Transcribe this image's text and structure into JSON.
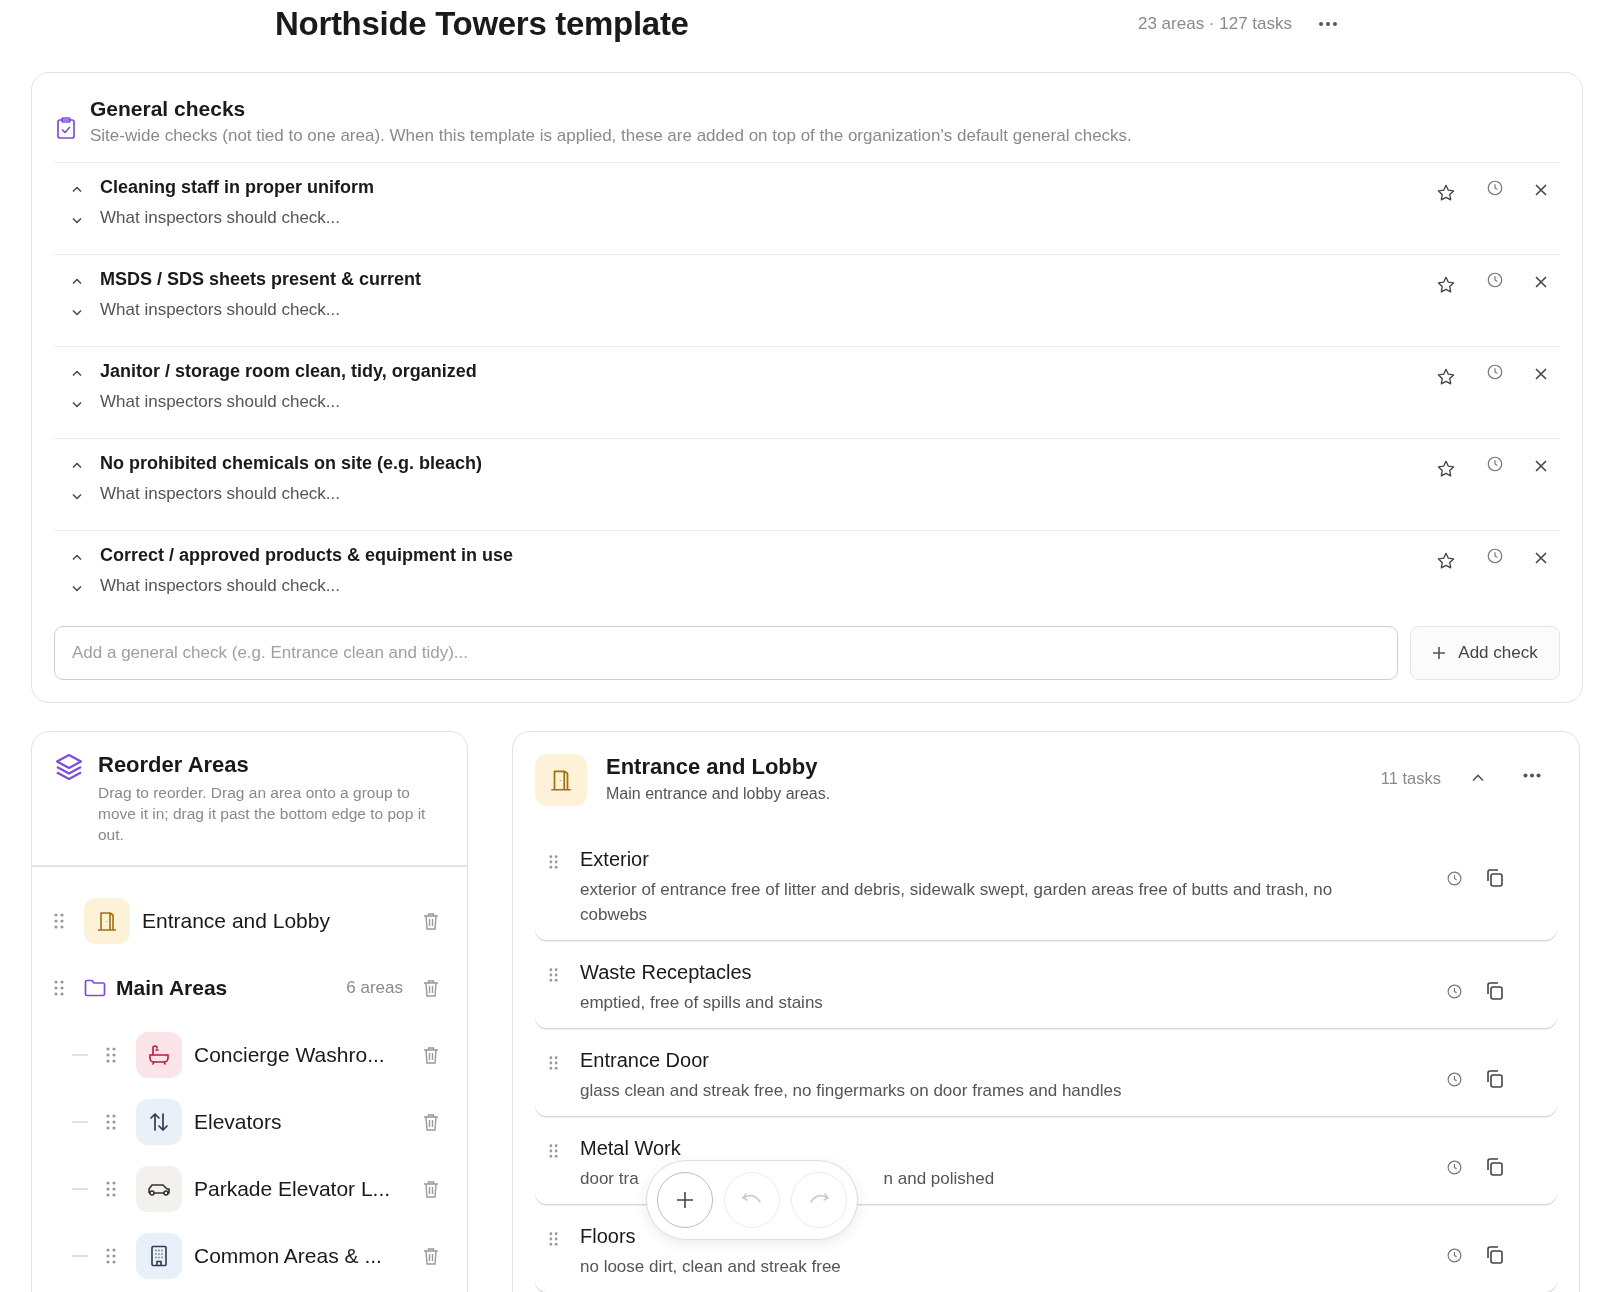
{
  "header": {
    "title": "Northside Towers template",
    "summary": "23 areas · 127 tasks"
  },
  "general_checks": {
    "title": "General checks",
    "description": "Site-wide checks (not tied to one area). When this template is applied, these are added on top of the organization's default general checks.",
    "checks": [
      {
        "title": "Cleaning staff in proper uniform",
        "placeholder": "What inspectors should check..."
      },
      {
        "title": "MSDS / SDS sheets present & current",
        "placeholder": "What inspectors should check..."
      },
      {
        "title": "Janitor / storage room clean, tidy, organized",
        "placeholder": "What inspectors should check..."
      },
      {
        "title": "No prohibited chemicals on site (e.g. bleach)",
        "placeholder": "What inspectors should check..."
      },
      {
        "title": "Correct / approved products & equipment in use",
        "placeholder": "What inspectors should check..."
      }
    ],
    "add_field": {
      "placeholder": "Add a general check (e.g. Entrance clean and tidy)..."
    },
    "add_button": "Add check"
  },
  "reorder_panel": {
    "title": "Reorder Areas",
    "description": "Drag to reorder. Drag an area onto a group to move it in; drag it past the bottom edge to pop it out.",
    "items": [
      {
        "kind": "area",
        "name": "Entrance and Lobby",
        "color": "#fdf2d8"
      },
      {
        "kind": "group",
        "name": "Main Areas",
        "count": "6 areas",
        "children": [
          {
            "kind": "area",
            "name": "Concierge Washro...",
            "color": "#fbe4e8"
          },
          {
            "kind": "area",
            "name": "Elevators",
            "color": "#eaf0f8"
          },
          {
            "kind": "area",
            "name": "Parkade Elevator L...",
            "color": "#f3f1ee"
          },
          {
            "kind": "area",
            "name": "Common Areas & ...",
            "color": "#eaf0f8"
          }
        ]
      }
    ]
  },
  "area_detail": {
    "title": "Entrance and Lobby",
    "subtitle": "Main entrance and lobby areas.",
    "task_count": "11 tasks",
    "expanded": true,
    "tasks": [
      {
        "title": "Exterior",
        "description": "exterior of entrance free of litter and debris, sidewalk swept, garden areas free of butts and trash, no cobwebs"
      },
      {
        "title": "Waste Receptacles",
        "description": "emptied, free of spills and stains"
      },
      {
        "title": "Entrance Door",
        "description": "glass clean and streak free, no fingermarks on door frames and handles"
      },
      {
        "title": "Metal Work",
        "description_parts": [
          "door tra",
          "n and polished"
        ]
      },
      {
        "title": "Floors",
        "description": "no loose dirt, clean and streak free"
      }
    ]
  },
  "floating_toolbar": {
    "buttons": [
      {
        "kind": "add",
        "disabled": false
      },
      {
        "kind": "undo",
        "disabled": true
      },
      {
        "kind": "redo",
        "disabled": true
      }
    ]
  }
}
